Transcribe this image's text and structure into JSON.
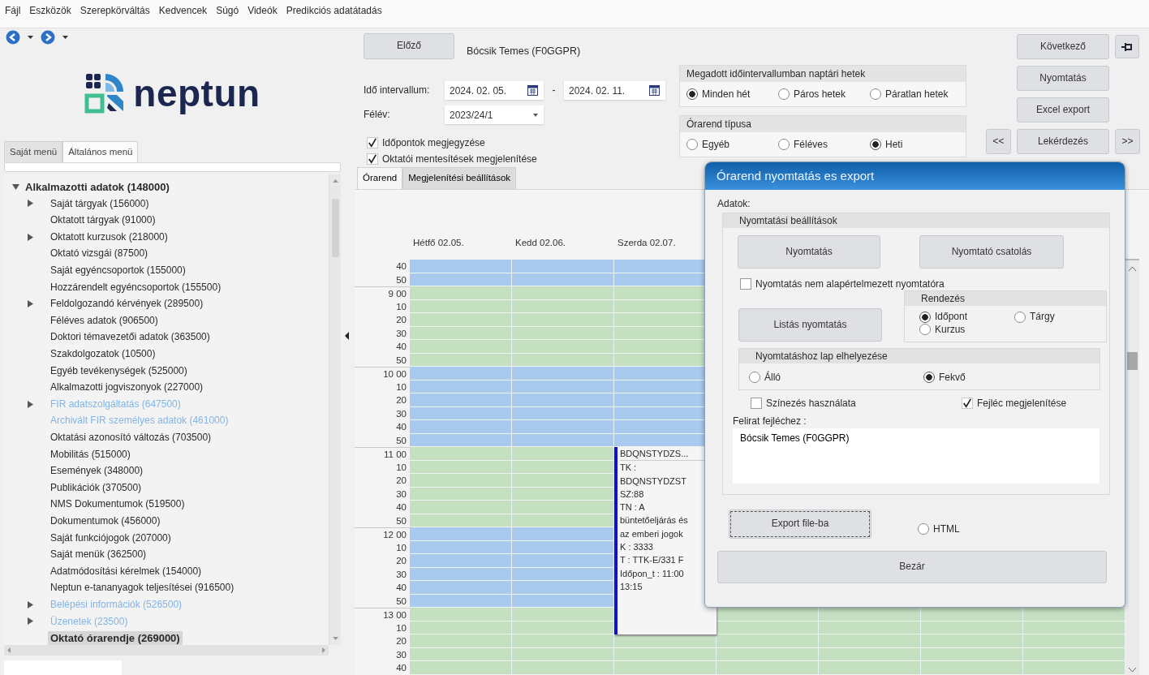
{
  "menu_bar": [
    "Fájl",
    "Eszközök",
    "Szerepkörváltás",
    "Kedvencek",
    "Súgó",
    "Videók",
    "Predikciós adatátadás"
  ],
  "sidebar": {
    "tabs": [
      {
        "label": "Saját menü",
        "selected": false
      },
      {
        "label": "Általános menü",
        "selected": true
      }
    ],
    "logo_text": "neptun",
    "tree": {
      "label": "Alkalmazotti adatok (148000)",
      "expanded": true,
      "children": [
        {
          "label": "Saját tárgyak (156000)",
          "kind": "group",
          "dimmed": false,
          "selected": false
        },
        {
          "label": "Oktatott tárgyak (91000)",
          "kind": "item",
          "dimmed": false,
          "selected": false
        },
        {
          "label": "Oktatott kurzusok (218000)",
          "kind": "group",
          "dimmed": false,
          "selected": false
        },
        {
          "label": "Oktató vizsgái (87500)",
          "kind": "item",
          "dimmed": false,
          "selected": false
        },
        {
          "label": "Saját egyéncsoportok (155000)",
          "kind": "item",
          "dimmed": false,
          "selected": false
        },
        {
          "label": "Hozzárendelt egyéncsoportok (155500)",
          "kind": "item",
          "dimmed": false,
          "selected": false
        },
        {
          "label": "Feldolgozandó kérvények (289500)",
          "kind": "group",
          "dimmed": false,
          "selected": false
        },
        {
          "label": "Féléves adatok (906500)",
          "kind": "item",
          "dimmed": false,
          "selected": false
        },
        {
          "label": "Doktori témavezetői adatok (363500)",
          "kind": "item",
          "dimmed": false,
          "selected": false
        },
        {
          "label": "Szakdolgozatok (10500)",
          "kind": "item",
          "dimmed": false,
          "selected": false
        },
        {
          "label": "Egyéb tevékenységek (525000)",
          "kind": "item",
          "dimmed": false,
          "selected": false
        },
        {
          "label": "Alkalmazotti jogviszonyok (227000)",
          "kind": "item",
          "dimmed": false,
          "selected": false
        },
        {
          "label": "FIR adatszolgáltatás (647500)",
          "kind": "group",
          "dimmed": true,
          "selected": false
        },
        {
          "label": "Archivált FIR személyes adatok (461000)",
          "kind": "item",
          "dimmed": true,
          "selected": false
        },
        {
          "label": "Oktatási azonosító változás (703500)",
          "kind": "item",
          "dimmed": false,
          "selected": false
        },
        {
          "label": "Mobilitás (515000)",
          "kind": "item",
          "dimmed": false,
          "selected": false
        },
        {
          "label": "Események (348000)",
          "kind": "item",
          "dimmed": false,
          "selected": false
        },
        {
          "label": "Publikációk (370500)",
          "kind": "item",
          "dimmed": false,
          "selected": false
        },
        {
          "label": "NMS Dokumentumok (519500)",
          "kind": "item",
          "dimmed": false,
          "selected": false
        },
        {
          "label": "Dokumentumok (456000)",
          "kind": "item",
          "dimmed": false,
          "selected": false
        },
        {
          "label": "Saját funkciójogok (207000)",
          "kind": "item",
          "dimmed": false,
          "selected": false
        },
        {
          "label": "Saját menük (362500)",
          "kind": "item",
          "dimmed": false,
          "selected": false
        },
        {
          "label": "Adatmódosítási kérelmek (154000)",
          "kind": "item",
          "dimmed": false,
          "selected": false
        },
        {
          "label": "Neptun e-tananyagok teljesítései (916500)",
          "kind": "item",
          "dimmed": false,
          "selected": false
        },
        {
          "label": "Belépési információk (526500)",
          "kind": "group",
          "dimmed": true,
          "selected": false
        },
        {
          "label": "Üzenetek (23500)",
          "kind": "group",
          "dimmed": true,
          "selected": false
        },
        {
          "label": "Oktató órarendje (269000)",
          "kind": "item",
          "dimmed": false,
          "selected": true
        }
      ]
    }
  },
  "toolbar": {
    "prev_button": "Előző",
    "person": "Bócsik Temes (F0GGPR)",
    "interval_label": "Idő intervallum:",
    "date_from": "2024. 02. 05.",
    "date_separator": "-",
    "date_to": "2024. 02. 11.",
    "semester_label": "Félév:",
    "semester": "2023/24/1",
    "options": [
      {
        "label": "Időpontok megjegyzése",
        "checked": true
      },
      {
        "label": "Oktatói mentesítések megjelenítése",
        "checked": true
      }
    ],
    "tabs": [
      {
        "label": "Órarend",
        "selected": true
      },
      {
        "label": "Megjelenítési beállítások",
        "selected": false
      }
    ]
  },
  "week_filter": {
    "title": "Megadott időintervallumban naptári hetek",
    "options": [
      {
        "label": "Minden hét",
        "selected": true
      },
      {
        "label": "Páros hetek",
        "selected": false
      },
      {
        "label": "Páratlan hetek",
        "selected": false
      }
    ]
  },
  "timetable_type": {
    "title": "Órarend típusa",
    "options": [
      {
        "label": "Egyéb",
        "selected": false
      },
      {
        "label": "Féléves",
        "selected": false
      },
      {
        "label": "Heti",
        "selected": true
      }
    ]
  },
  "actions": {
    "next": "Következő",
    "print": "Nyomtatás",
    "excel_export": "Excel export",
    "page_back": "<<",
    "query": "Lekérdezés",
    "page_forward": ">>"
  },
  "calendar": {
    "days": [
      {
        "label": "Hétfő 02.05."
      },
      {
        "label": "Kedd 02.06."
      },
      {
        "label": "Szerda 02.07."
      }
    ],
    "rows": [
      {
        "label": "40",
        "color": "#a9c9ee"
      },
      {
        "label": "50",
        "color": "#a9c9ee"
      },
      {
        "label": "9 00",
        "color": "#c5e0c1"
      },
      {
        "label": "10",
        "color": "#c5e0c1"
      },
      {
        "label": "20",
        "color": "#c5e0c1"
      },
      {
        "label": "30",
        "color": "#c5e0c1"
      },
      {
        "label": "40",
        "color": "#c5e0c1"
      },
      {
        "label": "50",
        "color": "#c5e0c1"
      },
      {
        "label": "10 00",
        "color": "#a9c9ee"
      },
      {
        "label": "10",
        "color": "#a9c9ee"
      },
      {
        "label": "20",
        "color": "#a9c9ee"
      },
      {
        "label": "30",
        "color": "#a9c9ee"
      },
      {
        "label": "40",
        "color": "#a9c9ee"
      },
      {
        "label": "50",
        "color": "#a9c9ee"
      },
      {
        "label": "11 00",
        "color": "#c5e0c1"
      },
      {
        "label": "10",
        "color": "#c5e0c1"
      },
      {
        "label": "20",
        "color": "#c5e0c1"
      },
      {
        "label": "30",
        "color": "#c5e0c1"
      },
      {
        "label": "40",
        "color": "#c5e0c1"
      },
      {
        "label": "50",
        "color": "#c5e0c1"
      },
      {
        "label": "12 00",
        "color": "#a9c9ee"
      },
      {
        "label": "10",
        "color": "#a9c9ee"
      },
      {
        "label": "20",
        "color": "#a9c9ee"
      },
      {
        "label": "30",
        "color": "#a9c9ee"
      },
      {
        "label": "40",
        "color": "#a9c9ee"
      },
      {
        "label": "50",
        "color": "#a9c9ee"
      },
      {
        "label": "13 00",
        "color": "#c5e0c1"
      },
      {
        "label": "10",
        "color": "#c5e0c1"
      },
      {
        "label": "20",
        "color": "#c5e0c1"
      },
      {
        "label": "30",
        "color": "#c5e0c1"
      },
      {
        "label": "40",
        "color": "#c5e0c1"
      }
    ],
    "event": {
      "title": "BDQNSTYDZS...",
      "lines": [
        "TK :",
        "BDQNSTYDZST",
        "SZ:88",
        "TN : A",
        "büntetőeljárás és",
        "az emberi jogok",
        "K : 3333",
        "T : TTK-E/331 F",
        "Időpon_t : 11:00",
        "13:15"
      ]
    }
  },
  "dialog": {
    "title": "Órarend nyomtatás es export",
    "data_label": "Adatok:",
    "print_settings": {
      "title": "Nyomtatási beállítások",
      "print_button": "Nyomtatás",
      "attach_button": "Nyomtató csatolás",
      "non_default_printer": {
        "label": "Nyomtatás nem alapértelmezett nyomtatóra",
        "checked": false
      },
      "list_print_button": "Listás nyomtatás",
      "sort": {
        "title": "Rendezés",
        "options": [
          {
            "label": "Időpont",
            "selected": true
          },
          {
            "label": "Tárgy",
            "selected": false
          },
          {
            "label": "Kurzus",
            "selected": false
          }
        ]
      },
      "orientation": {
        "title": "Nyomtatáshoz lap elhelyezése",
        "options": [
          {
            "label": "Álló",
            "selected": false
          },
          {
            "label": "Fekvő",
            "selected": true
          }
        ]
      },
      "coloring": {
        "label": "Színezés használata",
        "checked": false
      },
      "show_header": {
        "label": "Fejléc megjelenítése",
        "checked": true
      },
      "header_caption_label": "Felirat fejléchez :",
      "header_caption": "Bócsik Temes (F0GGPR)"
    },
    "export_button": "Export file-ba",
    "html_option": {
      "label": "HTML",
      "selected": false
    },
    "close_button": "Bezár"
  }
}
